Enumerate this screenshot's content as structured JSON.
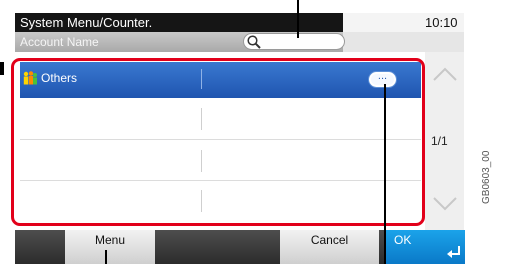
{
  "header": {
    "title": "System Menu/Counter.",
    "time": "10:10"
  },
  "subheader": {
    "label": "Account Name",
    "search_placeholder": ""
  },
  "list": {
    "rows": [
      {
        "label": "Others",
        "selected": true
      },
      {
        "label": ""
      },
      {
        "label": ""
      },
      {
        "label": ""
      }
    ],
    "detail_button_label": "..."
  },
  "pagination": {
    "current": "1/1"
  },
  "footer": {
    "menu_label": "Menu",
    "cancel_label": "Cancel",
    "ok_label": "OK"
  },
  "figure_code": "GB0603_00",
  "colors": {
    "highlight": "#e2001a",
    "selected_row": "#2a63bf",
    "ok_button": "#0a89d6"
  }
}
